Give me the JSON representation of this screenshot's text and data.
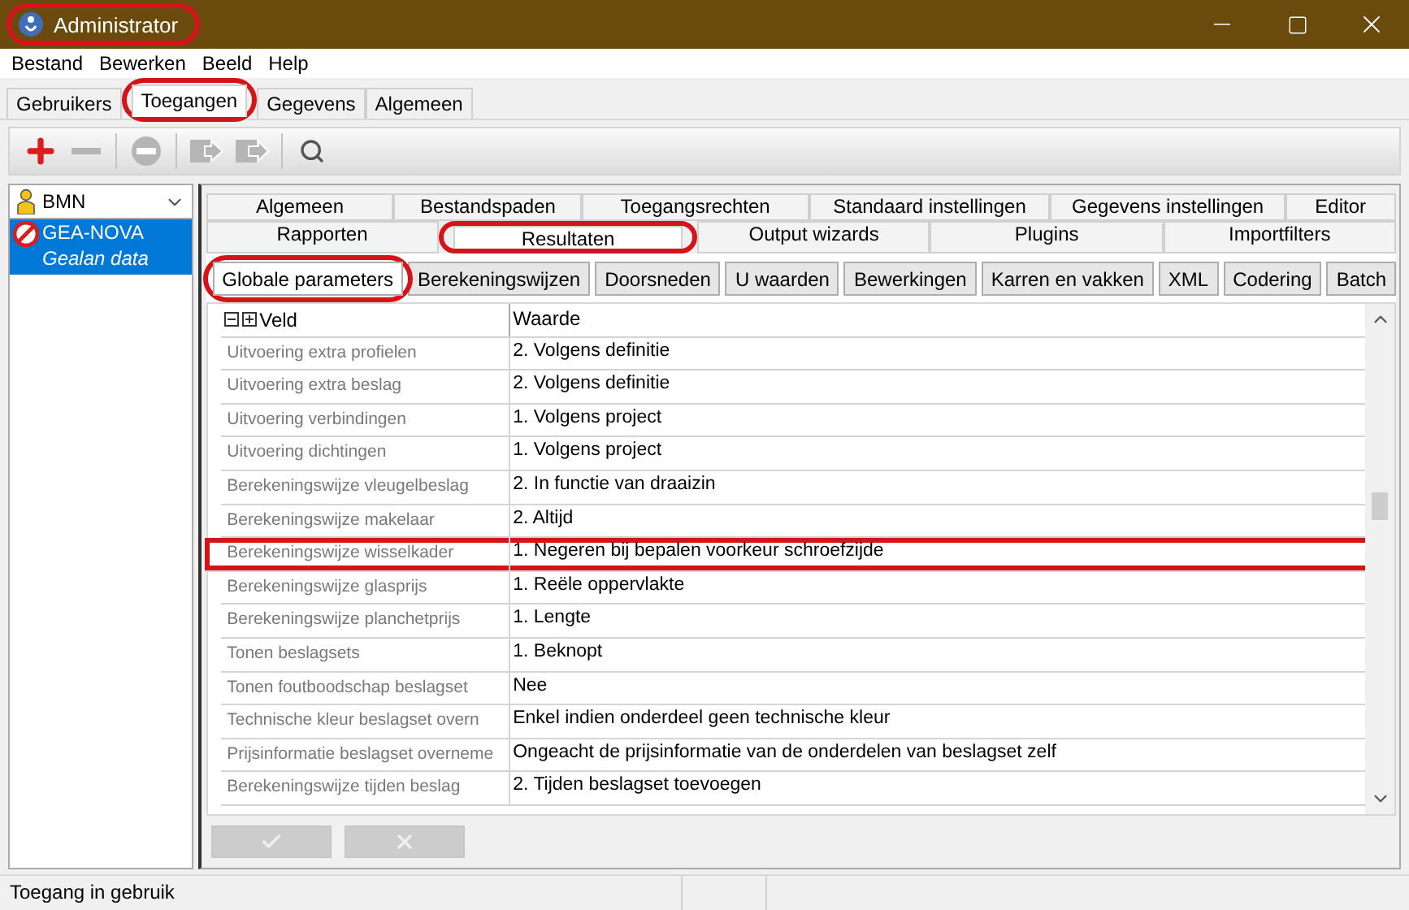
{
  "window": {
    "title": "Administrator",
    "highlighted": true
  },
  "menu": [
    "Bestand",
    "Bewerken",
    "Beeld",
    "Help"
  ],
  "main_tabs": [
    {
      "label": "Gebruikers",
      "selected": false,
      "highlighted": false
    },
    {
      "label": "Toegangen",
      "selected": true,
      "highlighted": true
    },
    {
      "label": "Gegevens",
      "selected": false,
      "highlighted": false
    },
    {
      "label": "Algemeen",
      "selected": false,
      "highlighted": false
    }
  ],
  "toolbar": [
    {
      "kind": "add",
      "disabled": false
    },
    {
      "kind": "remove",
      "disabled": true
    },
    {
      "kind": "block",
      "disabled": true
    },
    {
      "kind": "import",
      "disabled": true
    },
    {
      "kind": "export",
      "disabled": true
    },
    {
      "kind": "search",
      "disabled": false
    }
  ],
  "sidebar": {
    "dropdown": {
      "value": "BMN"
    },
    "items": [
      {
        "title": "GEA-NOVA",
        "subtitle": "Gealan data",
        "selected": true
      }
    ]
  },
  "settings_tabs": [
    {
      "tabs": [
        {
          "label": "Algemeen",
          "selected": false,
          "highlighted": false
        },
        {
          "label": "Bestandspaden",
          "selected": false,
          "highlighted": false
        },
        {
          "label": "Toegangsrechten",
          "selected": false,
          "highlighted": false
        },
        {
          "label": "Standaard instellingen",
          "selected": false,
          "highlighted": false
        },
        {
          "label": "Gegevens instellingen",
          "selected": false,
          "highlighted": false
        },
        {
          "label": "Editor",
          "selected": false,
          "highlighted": false
        }
      ]
    },
    {
      "tabs": [
        {
          "label": "Rapporten",
          "selected": false,
          "highlighted": false
        },
        {
          "label": "Resultaten",
          "selected": true,
          "highlighted": true
        },
        {
          "label": "Output wizards",
          "selected": false,
          "highlighted": false
        },
        {
          "label": "Plugins",
          "selected": false,
          "highlighted": false
        },
        {
          "label": "Importfilters",
          "selected": false,
          "highlighted": false
        }
      ]
    }
  ],
  "sub_tabs": [
    {
      "label": "Globale parameters",
      "selected": true,
      "highlighted": true
    },
    {
      "label": "Berekeningswijzen",
      "selected": false,
      "highlighted": false
    },
    {
      "label": "Doorsneden",
      "selected": false,
      "highlighted": false
    },
    {
      "label": "U waarden",
      "selected": false,
      "highlighted": false
    },
    {
      "label": "Bewerkingen",
      "selected": false,
      "highlighted": false
    },
    {
      "label": "Karren en vakken",
      "selected": false,
      "highlighted": false
    },
    {
      "label": "XML",
      "selected": false,
      "highlighted": false
    },
    {
      "label": "Codering",
      "selected": false,
      "highlighted": false
    },
    {
      "label": "Batch",
      "selected": false,
      "highlighted": false
    }
  ],
  "grid": {
    "columns": [
      "Veld",
      "Waarde"
    ],
    "rows": [
      {
        "field": "Uitvoering extra profielen",
        "value": "2. Volgens definitie",
        "highlighted": false
      },
      {
        "field": "Uitvoering extra beslag",
        "value": "2. Volgens definitie",
        "highlighted": false
      },
      {
        "field": "Uitvoering verbindingen",
        "value": "1. Volgens project",
        "highlighted": false
      },
      {
        "field": "Uitvoering dichtingen",
        "value": "1. Volgens project",
        "highlighted": false
      },
      {
        "field": "Berekeningswijze vleugelbeslag",
        "value": "2. In functie van draaizin",
        "highlighted": false
      },
      {
        "field": "Berekeningswijze makelaar",
        "value": "2. Altijd",
        "highlighted": false
      },
      {
        "field": "Berekeningswijze wisselkader",
        "value": "1. Negeren bij bepalen voorkeur schroefzijde",
        "highlighted": true
      },
      {
        "field": "Berekeningswijze glasprijs",
        "value": "1. Reële oppervlakte",
        "highlighted": false
      },
      {
        "field": "Berekeningswijze planchetprijs",
        "value": "1. Lengte",
        "highlighted": false
      },
      {
        "field": "Tonen beslagsets",
        "value": "1. Beknopt",
        "highlighted": false
      },
      {
        "field": "Tonen foutboodschap beslagset",
        "value": "Nee",
        "highlighted": false
      },
      {
        "field": "Technische kleur beslagset overn",
        "value": "Enkel indien onderdeel geen technische kleur",
        "highlighted": false
      },
      {
        "field": "Prijsinformatie beslagset overneme",
        "value": "Ongeacht de prijsinformatie van de onderdelen van beslagset zelf",
        "highlighted": false
      },
      {
        "field": "Berekeningswijze tijden beslag",
        "value": "2.  Tijden beslagset toevoegen",
        "highlighted": false
      }
    ]
  },
  "actions": [
    {
      "kind": "confirm",
      "disabled": true
    },
    {
      "kind": "cancel",
      "disabled": true
    }
  ],
  "status_bar": {
    "text": "Toegang in gebruik"
  }
}
